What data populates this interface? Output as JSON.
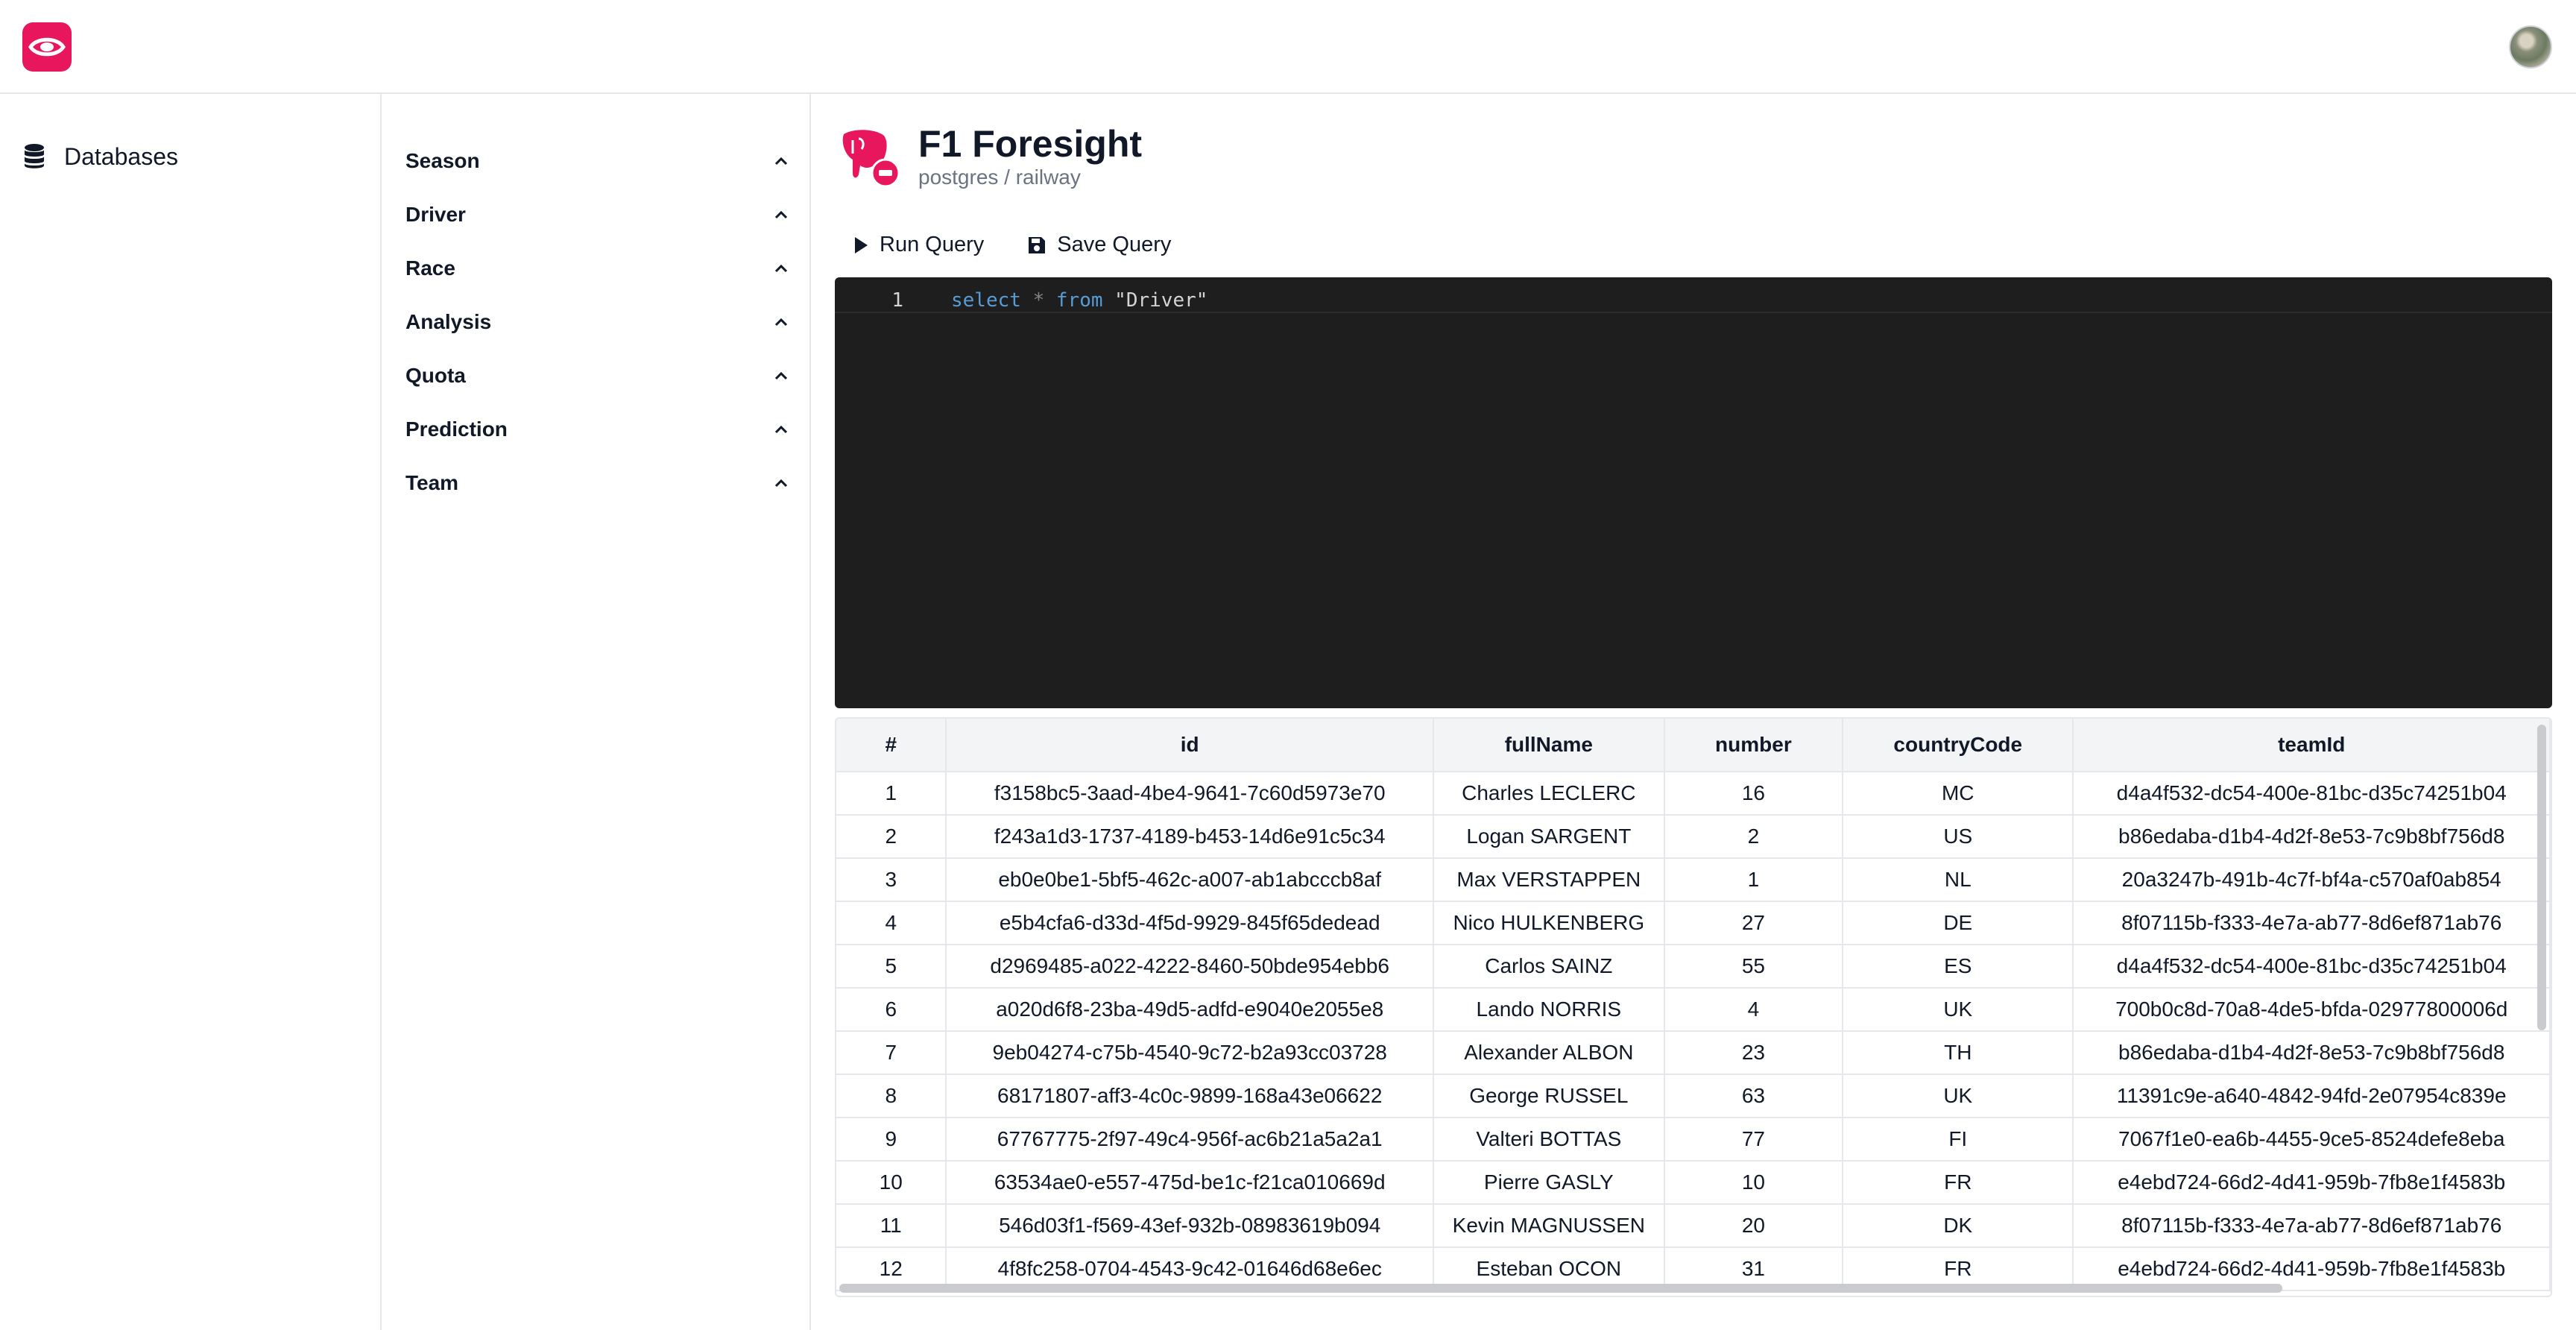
{
  "nav": {
    "databases_label": "Databases"
  },
  "tables_list": [
    "Season",
    "Driver",
    "Race",
    "Analysis",
    "Quota",
    "Prediction",
    "Team"
  ],
  "database": {
    "title": "F1 Foresight",
    "subtitle": "postgres / railway"
  },
  "toolbar": {
    "run_label": "Run Query",
    "save_label": "Save Query"
  },
  "editor": {
    "line_number": "1",
    "keyword_select": "select",
    "operator": "*",
    "keyword_from": "from",
    "table_literal": "\"Driver\""
  },
  "results": {
    "columns": [
      "#",
      "id",
      "fullName",
      "number",
      "countryCode",
      "teamId"
    ],
    "rows": [
      [
        "1",
        "f3158bc5-3aad-4be4-9641-7c60d5973e70",
        "Charles LECLERC",
        "16",
        "MC",
        "d4a4f532-dc54-400e-81bc-d35c74251b04"
      ],
      [
        "2",
        "f243a1d3-1737-4189-b453-14d6e91c5c34",
        "Logan SARGENT",
        "2",
        "US",
        "b86edaba-d1b4-4d2f-8e53-7c9b8bf756d8"
      ],
      [
        "3",
        "eb0e0be1-5bf5-462c-a007-ab1abcccb8af",
        "Max VERSTAPPEN",
        "1",
        "NL",
        "20a3247b-491b-4c7f-bf4a-c570af0ab854"
      ],
      [
        "4",
        "e5b4cfa6-d33d-4f5d-9929-845f65dedead",
        "Nico HULKENBERG",
        "27",
        "DE",
        "8f07115b-f333-4e7a-ab77-8d6ef871ab76"
      ],
      [
        "5",
        "d2969485-a022-4222-8460-50bde954ebb6",
        "Carlos SAINZ",
        "55",
        "ES",
        "d4a4f532-dc54-400e-81bc-d35c74251b04"
      ],
      [
        "6",
        "a020d6f8-23ba-49d5-adfd-e9040e2055e8",
        "Lando NORRIS",
        "4",
        "UK",
        "700b0c8d-70a8-4de5-bfda-02977800006d"
      ],
      [
        "7",
        "9eb04274-c75b-4540-9c72-b2a93cc03728",
        "Alexander ALBON",
        "23",
        "TH",
        "b86edaba-d1b4-4d2f-8e53-7c9b8bf756d8"
      ],
      [
        "8",
        "68171807-aff3-4c0c-9899-168a43e06622",
        "George RUSSEL",
        "63",
        "UK",
        "11391c9e-a640-4842-94fd-2e07954c839e"
      ],
      [
        "9",
        "67767775-2f97-49c4-956f-ac6b21a5a2a1",
        "Valteri BOTTAS",
        "77",
        "FI",
        "7067f1e0-ea6b-4455-9ce5-8524defe8eba"
      ],
      [
        "10",
        "63534ae0-e557-475d-be1c-f21ca010669d",
        "Pierre GASLY",
        "10",
        "FR",
        "e4ebd724-66d2-4d41-959b-7fb8e1f4583b"
      ],
      [
        "11",
        "546d03f1-f569-43ef-932b-08983619b094",
        "Kevin MAGNUSSEN",
        "20",
        "DK",
        "8f07115b-f333-4e7a-ab77-8d6ef871ab76"
      ],
      [
        "12",
        "4f8fc258-0704-4543-9c42-01646d68e6ec",
        "Esteban OCON",
        "31",
        "FR",
        "e4ebd724-66d2-4d41-959b-7fb8e1f4583b"
      ]
    ]
  },
  "colors": {
    "brand": "#e8175d",
    "editor_bg": "#1e1e1e",
    "keyword": "#569cd6"
  },
  "icons": {
    "logo": "eye-logo-icon",
    "nav": "database-icon",
    "table_toggle": "chevron-up-icon",
    "db": "postgres-elephant-icon",
    "run": "play-icon",
    "save": "floppy-disk-icon"
  }
}
